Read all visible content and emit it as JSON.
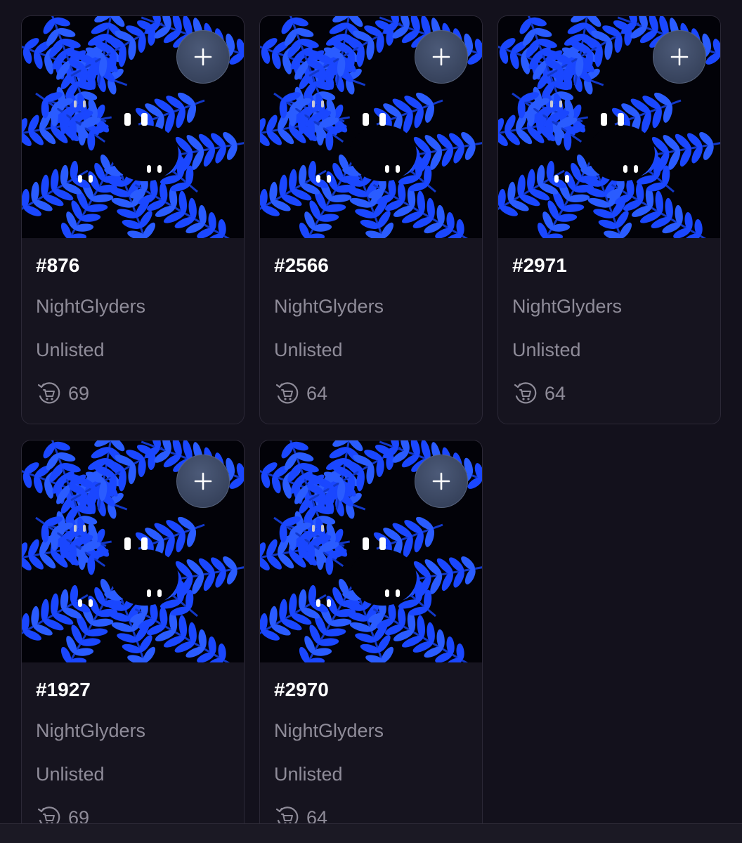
{
  "colors": {
    "background": "#13111c",
    "card_background": "#16141f",
    "card_border": "#2b2836",
    "title": "#ffffff",
    "muted_text": "#8f8c99",
    "art_blue": "#1a47ff",
    "art_dark": "#020208"
  },
  "icons": {
    "add": "plus-icon",
    "offers": "cart-icon"
  },
  "cards": [
    {
      "id": "#876",
      "collection": "NightGlyders",
      "status": "Unlisted",
      "offers": "69"
    },
    {
      "id": "#2566",
      "collection": "NightGlyders",
      "status": "Unlisted",
      "offers": "64"
    },
    {
      "id": "#2971",
      "collection": "NightGlyders",
      "status": "Unlisted",
      "offers": "64"
    },
    {
      "id": "#1927",
      "collection": "NightGlyders",
      "status": "Unlisted",
      "offers": "69"
    },
    {
      "id": "#2970",
      "collection": "NightGlyders",
      "status": "Unlisted",
      "offers": "64"
    }
  ]
}
